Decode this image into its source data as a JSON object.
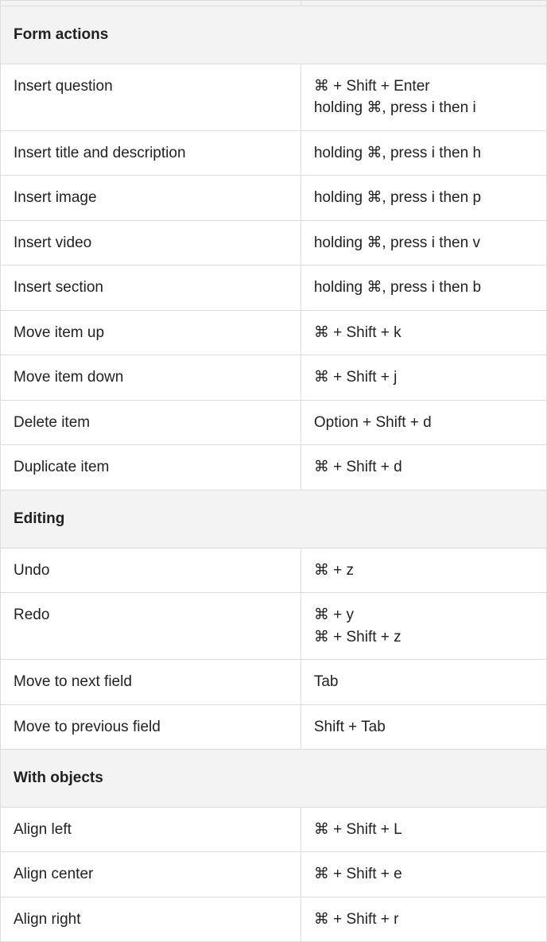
{
  "sections": [
    {
      "title": "Form actions",
      "rows": [
        {
          "name": "Insert question",
          "keys": [
            "⌘ + Shift + Enter",
            "holding ⌘, press i then i"
          ]
        },
        {
          "name": "Insert title and description",
          "keys": [
            "holding ⌘, press i then h"
          ]
        },
        {
          "name": "Insert image",
          "keys": [
            "holding ⌘, press i then p"
          ]
        },
        {
          "name": "Insert video",
          "keys": [
            "holding ⌘, press i then v"
          ]
        },
        {
          "name": "Insert section",
          "keys": [
            "holding ⌘, press i then b"
          ]
        },
        {
          "name": "Move item up",
          "keys": [
            "⌘ + Shift + k"
          ]
        },
        {
          "name": "Move item down",
          "keys": [
            "⌘ + Shift + j"
          ]
        },
        {
          "name": "Delete item",
          "keys": [
            "Option + Shift + d"
          ]
        },
        {
          "name": "Duplicate item",
          "keys": [
            "⌘ + Shift + d"
          ]
        }
      ]
    },
    {
      "title": "Editing",
      "rows": [
        {
          "name": "Undo",
          "keys": [
            "⌘ + z"
          ]
        },
        {
          "name": "Redo",
          "keys": [
            "⌘ + y",
            "⌘ + Shift + z"
          ]
        },
        {
          "name": "Move to next field",
          "keys": [
            "Tab"
          ]
        },
        {
          "name": "Move to previous field",
          "keys": [
            "Shift + Tab"
          ]
        }
      ]
    },
    {
      "title": "With objects",
      "rows": [
        {
          "name": "Align left",
          "keys": [
            "⌘ + Shift + L"
          ]
        },
        {
          "name": "Align center",
          "keys": [
            "⌘ + Shift + e"
          ]
        },
        {
          "name": "Align right",
          "keys": [
            "⌘ + Shift + r"
          ]
        }
      ]
    }
  ]
}
